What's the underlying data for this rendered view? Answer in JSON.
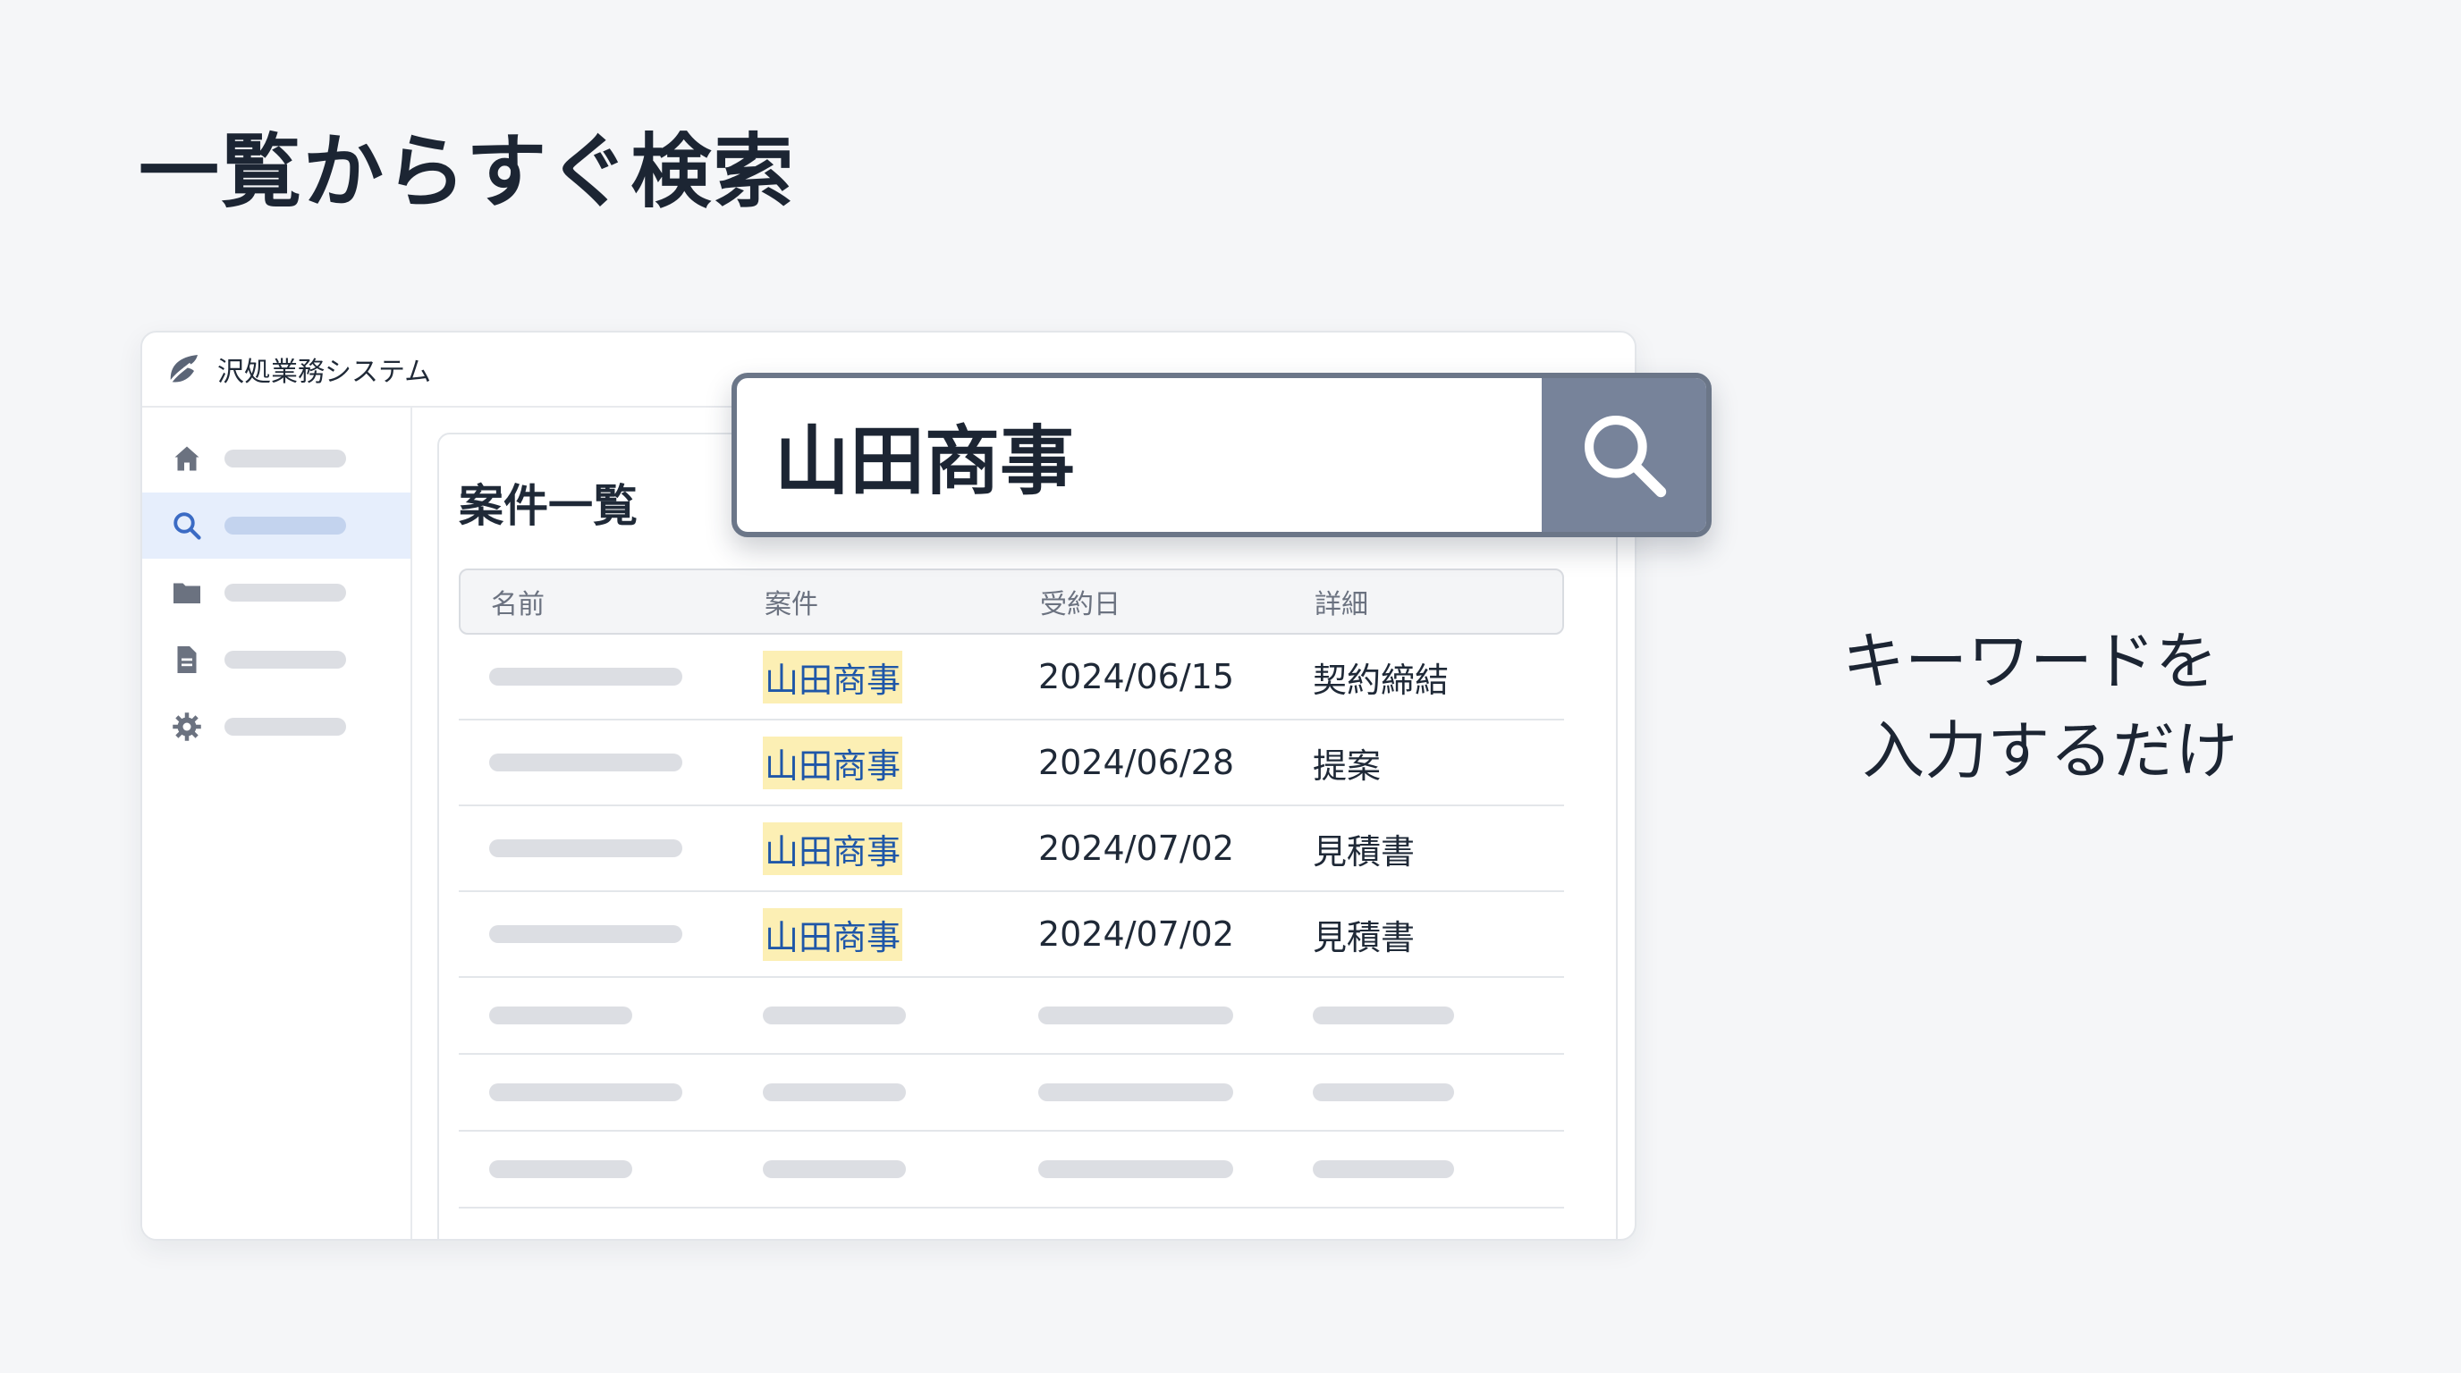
{
  "headline": "一覧からすぐ検索",
  "app": {
    "title": "沢処業務システム",
    "logo_icon": "leaf-logo-icon"
  },
  "sidebar": {
    "items": [
      {
        "icon": "home-icon",
        "active": false
      },
      {
        "icon": "search-icon",
        "active": true
      },
      {
        "icon": "folder-icon",
        "active": false
      },
      {
        "icon": "document-icon",
        "active": false
      },
      {
        "icon": "gear-icon",
        "active": false
      }
    ]
  },
  "list": {
    "title": "案件一覧",
    "columns": [
      "名前",
      "案件",
      "受約日",
      "詳細"
    ],
    "rows": [
      {
        "client": "山田商事",
        "date": "2024/06/15",
        "detail": "契約締結"
      },
      {
        "client": "山田商事",
        "date": "2024/06/28",
        "detail": "提案"
      },
      {
        "client": "山田商事",
        "date": "2024/07/02",
        "detail": "見積書"
      },
      {
        "client": "山田商事",
        "date": "2024/07/02",
        "detail": "見積書"
      }
    ]
  },
  "search": {
    "value": "山田商事",
    "button_icon": "search-icon"
  },
  "caption": {
    "line1": "キーワードを",
    "line2": "入力するだけ"
  },
  "colors": {
    "highlight": "#fcefb4",
    "highlight_text": "#1f57a8",
    "search_border": "#6b7688",
    "search_button": "#77839a",
    "active_nav": "#e6eefc"
  }
}
